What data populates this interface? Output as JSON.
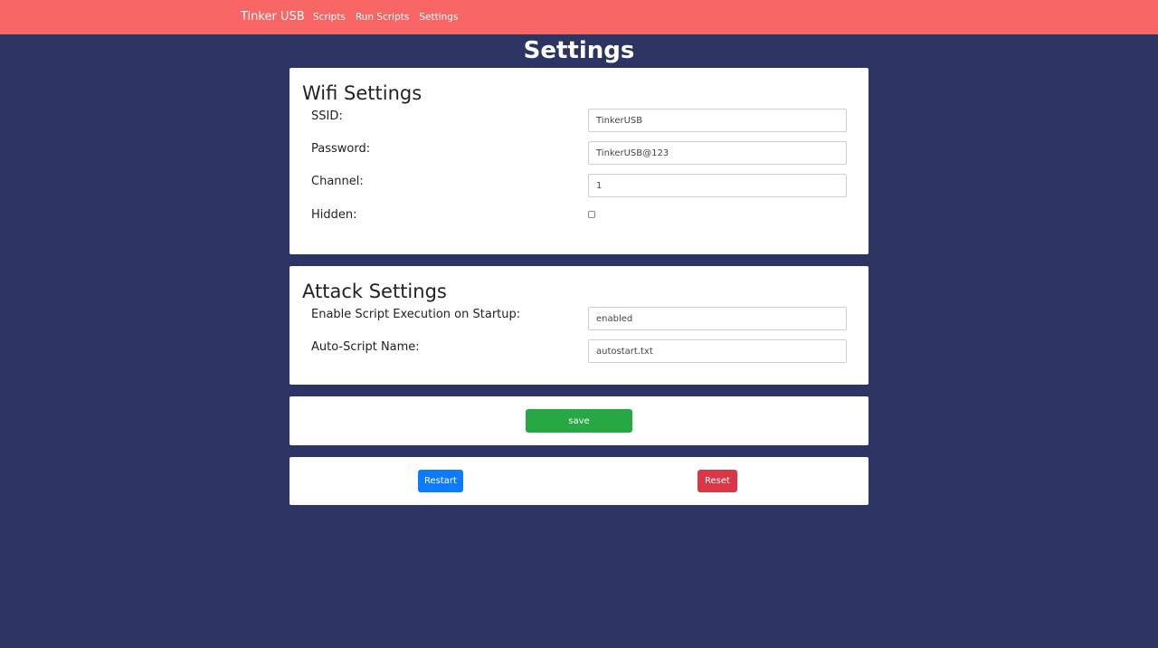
{
  "nav": {
    "brand": "Tinker USB",
    "links": [
      "Scripts",
      "Run Scripts",
      "Settings"
    ]
  },
  "page": {
    "title": "Settings"
  },
  "wifi": {
    "title": "Wifi Settings",
    "ssid_label": "SSID:",
    "ssid_value": "TinkerUSB",
    "password_label": "Password:",
    "password_value": "TinkerUSB@123",
    "channel_label": "Channel:",
    "channel_value": "1",
    "hidden_label": "Hidden:",
    "hidden_checked": false
  },
  "attack": {
    "title": "Attack Settings",
    "startup_label": "Enable Script Execution on Startup:",
    "startup_value": "enabled",
    "autoscript_label": "Auto-Script Name:",
    "autoscript_value": "autostart.txt"
  },
  "actions": {
    "save_label": "save",
    "restart_label": "Restart",
    "reset_label": "Reset"
  },
  "colors": {
    "navbar": "#f76565",
    "background": "#2b3462",
    "save": "#28a745",
    "restart": "#0d7bff",
    "reset": "#dc3545"
  }
}
